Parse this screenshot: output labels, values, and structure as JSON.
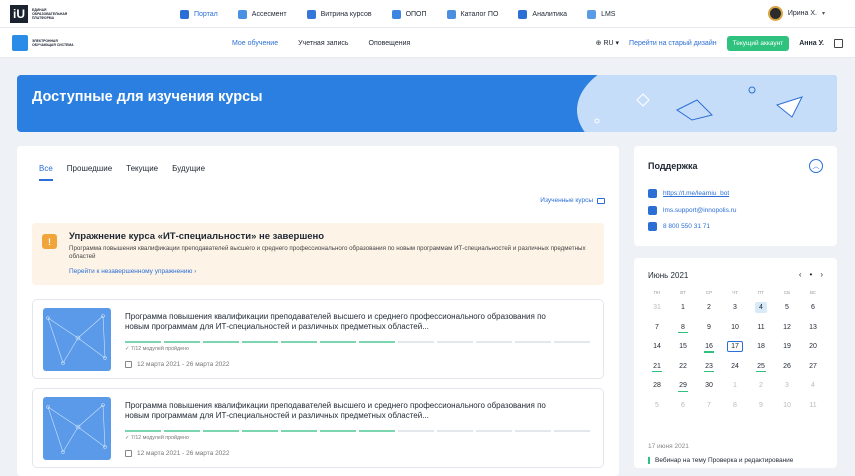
{
  "topbar": {
    "logo_text": "ЕДИНАЯ ОБРАЗОВАТЕЛЬНАЯ ПЛАТФОРМА",
    "nav": [
      {
        "label": "Портал",
        "icon": "portal-icon",
        "active": true
      },
      {
        "label": "Ассесмент",
        "icon": "check-icon"
      },
      {
        "label": "Витрина курсов",
        "icon": "cap-icon"
      },
      {
        "label": "ОПОП",
        "icon": "flag-icon"
      },
      {
        "label": "Каталог ПО",
        "icon": "box-icon"
      },
      {
        "label": "Аналитика",
        "icon": "chart-icon"
      },
      {
        "label": "LMS",
        "icon": "monitor-icon"
      }
    ],
    "user_name": "Ирина Х."
  },
  "subbar": {
    "logo_text": "ЭЛЕКТРОННАЯ ОБУЧАЮЩАЯ СИСТЕМА",
    "nav": [
      {
        "label": "Мое обучение",
        "active": true
      },
      {
        "label": "Учетная запись"
      },
      {
        "label": "Оповещения"
      }
    ],
    "lang": "RU",
    "old_design_link": "Перейти на старый дизайн",
    "current_account": "Текущий аккаунт",
    "user_short": "Анна У."
  },
  "hero": {
    "title": "Доступные для изучения курсы"
  },
  "main": {
    "tabs": [
      {
        "label": "Все",
        "active": true
      },
      {
        "label": "Прошедшие"
      },
      {
        "label": "Текущие"
      },
      {
        "label": "Будущие"
      }
    ],
    "studied_link": "Изученные курсы",
    "warning": {
      "title": "Упражнение курса «ИТ-специальности» не завершено",
      "desc": "Программа повышения квалификации преподавателей высшего и среднего профессионального образования по новым программам ИТ-специальностей и различных предметных областей",
      "link": "Перейти к незавершенному упражнению"
    },
    "courses": [
      {
        "title": "Программа повышения квалификации преподавателей высшего и среднего профессионального образования по новым программам для ИТ-специальностей и различных предметных областей...",
        "modules": "7/12 модулей пройдено",
        "progress": 0.5833,
        "dates": "12 марта 2021 - 26 марта 2022"
      },
      {
        "title": "Программа повышения квалификации преподавателей высшего и среднего профессионального образования по новым программам для ИТ-специальностей и различных предметных областей...",
        "modules": "7/12 модулей пройдено",
        "progress": 0.5833,
        "dates": "12 марта 2021 - 26 марта 2022"
      }
    ]
  },
  "support": {
    "title": "Поддержка",
    "telegram": "https://t.me/learniu_bot",
    "email": "lms.support@innopolis.ru",
    "phone": "8 800 550 31 71"
  },
  "calendar": {
    "month": "Июнь 2021",
    "weekdays": [
      "ПН",
      "ВТ",
      "СР",
      "ЧТ",
      "ПТ",
      "СБ",
      "ВС"
    ],
    "days": [
      {
        "d": "31",
        "muted": true
      },
      {
        "d": "1"
      },
      {
        "d": "2"
      },
      {
        "d": "3"
      },
      {
        "d": "4",
        "sel": true
      },
      {
        "d": "5"
      },
      {
        "d": "6"
      },
      {
        "d": "7"
      },
      {
        "d": "8",
        "ev": true
      },
      {
        "d": "9"
      },
      {
        "d": "10"
      },
      {
        "d": "11"
      },
      {
        "d": "12"
      },
      {
        "d": "13"
      },
      {
        "d": "14"
      },
      {
        "d": "15"
      },
      {
        "d": "16",
        "ev": true
      },
      {
        "d": "17",
        "today": true
      },
      {
        "d": "18"
      },
      {
        "d": "19"
      },
      {
        "d": "20"
      },
      {
        "d": "21",
        "ev": true
      },
      {
        "d": "22"
      },
      {
        "d": "23",
        "ev": true
      },
      {
        "d": "24"
      },
      {
        "d": "25",
        "ev": true
      },
      {
        "d": "26"
      },
      {
        "d": "27"
      },
      {
        "d": "28"
      },
      {
        "d": "29",
        "ev": true
      },
      {
        "d": "30"
      },
      {
        "d": "1",
        "muted": true
      },
      {
        "d": "2",
        "muted": true
      },
      {
        "d": "3",
        "muted": true
      },
      {
        "d": "4",
        "muted": true
      },
      {
        "d": "5",
        "muted": true
      },
      {
        "d": "6",
        "muted": true
      },
      {
        "d": "7",
        "muted": true
      },
      {
        "d": "8",
        "muted": true
      },
      {
        "d": "9",
        "muted": true
      },
      {
        "d": "10",
        "muted": true
      },
      {
        "d": "11",
        "muted": true
      }
    ],
    "event_date": "17 июня 2021",
    "event_title": "Вебинар на тему Проверка и редактирование"
  },
  "colors": {
    "accent": "#2b6fd6",
    "banner": "#2a7fe0",
    "success": "#2ec27e",
    "warning": "#f0a43a"
  }
}
